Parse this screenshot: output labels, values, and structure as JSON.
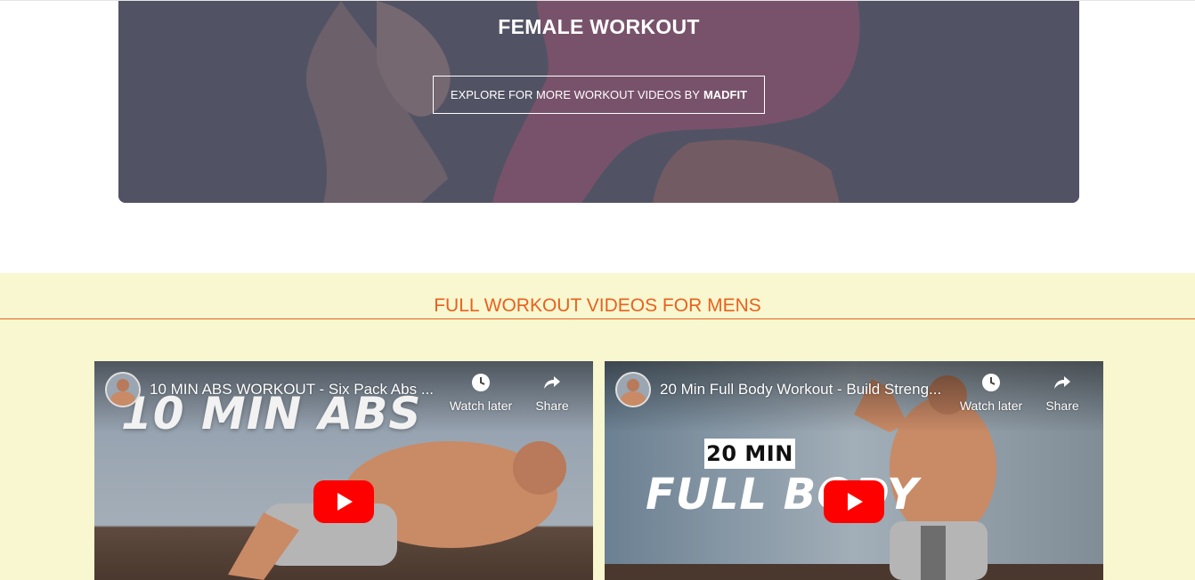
{
  "hero": {
    "title": "FEMALE WORKOUT",
    "button_text": "EXPLORE FOR MORE WORKOUT VIDEOS BY",
    "button_brand": "MADFIT"
  },
  "mens_section": {
    "title": "FULL WORKOUT VIDEOS FOR MENS",
    "accent_color": "#e8611f",
    "background_color": "#f8f7cf"
  },
  "videos": [
    {
      "title": "10 MIN ABS WORKOUT - Six Pack Abs ...",
      "thumbnail_text": "10 MIN ABS",
      "watch_later_label": "Watch later",
      "share_label": "Share"
    },
    {
      "title": "20 Min Full Body Workout - Build Streng...",
      "thumbnail_badge": "20 MIN",
      "thumbnail_text": "FULL BODY",
      "watch_later_label": "Watch later",
      "share_label": "Share"
    }
  ],
  "icons": {
    "watch_later": "clock-icon",
    "share": "share-arrow-icon",
    "play": "youtube-play-icon"
  }
}
